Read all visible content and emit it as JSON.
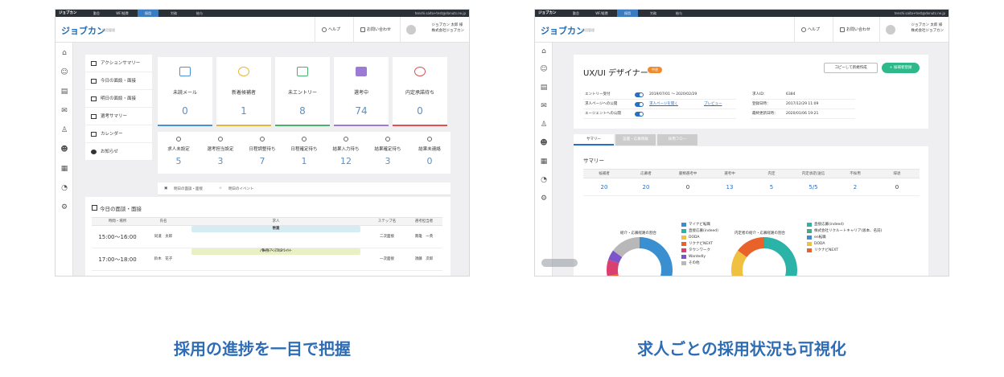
{
  "colors": {
    "accent": "#2e6db5",
    "brand": "#1d6fb8",
    "green": "#2fb88a",
    "orange": "#f08a2d"
  },
  "shotA": {
    "topbar": {
      "logo": "ジョブカン",
      "tabs": [
        "勤怠",
        "WF/経費",
        "採用",
        "労務",
        "給与"
      ],
      "active_tab": "採用",
      "email": "tenshi.saito+test@donuts.ne.jp"
    },
    "header": {
      "logo": "ジョブカン",
      "logo_sub": "採用管理",
      "help": "ヘルプ",
      "contact": "お問い合わせ",
      "user_name": "ジョブカン 太郎 様",
      "company": "株式会社ジョブカン"
    },
    "nav_icons": [
      "home-icon",
      "users-icon",
      "document-icon",
      "mail-icon",
      "person-icon",
      "group-icon",
      "calendar-icon",
      "chart-icon",
      "gear-icon"
    ],
    "submenu": [
      "アクションサマリー",
      "今日の面談・面接",
      "明日の面談・面接",
      "選考サマリー",
      "カレンダー",
      "お知らせ"
    ],
    "cards": [
      {
        "label": "未読メール",
        "value": "0",
        "color": "#4a90d9"
      },
      {
        "label": "新着候補者",
        "value": "1",
        "color": "#e0b83a"
      },
      {
        "label": "未エントリー",
        "value": "8",
        "color": "#4caf70"
      },
      {
        "label": "選考中",
        "value": "74",
        "color": "#9b7bd4"
      },
      {
        "label": "内定承諾待ち",
        "value": "0",
        "color": "#e05050"
      }
    ],
    "stats": [
      {
        "label": "求人未設定",
        "value": "5"
      },
      {
        "label": "選考担当設定",
        "value": "3"
      },
      {
        "label": "日程調整待ち",
        "value": "7"
      },
      {
        "label": "日程確定待ち",
        "value": "1"
      },
      {
        "label": "結果入力待ち",
        "value": "12"
      },
      {
        "label": "結果確定待ち",
        "value": "3"
      },
      {
        "label": "結果未連絡",
        "value": "0"
      }
    ],
    "event_tabs": [
      "明日の面談・面接",
      "明日のイベント"
    ],
    "schedule": {
      "title": "今日の面談・面接",
      "headers": [
        "時間・場所",
        "氏名",
        "求人",
        "ステップ名",
        "選考担当者"
      ],
      "rows": [
        {
          "time": "15:00〜16:00",
          "name": "同道　太郎",
          "job": "中途",
          "job_sub": "営業",
          "step": "二次面接",
          "owner": "南雄　一英",
          "color": "#d6ecf3"
        },
        {
          "time": "17:00〜18:00",
          "name": "鈴木　花子",
          "job": "パート・アルバイト",
          "job_sub": "事務アシスタント",
          "step": "一次面接",
          "owner": "須藤　次郎",
          "color": "#e9f0c4"
        }
      ]
    }
  },
  "shotB": {
    "topbar": {
      "logo": "ジョブカン",
      "tabs": [
        "勤怠",
        "WF/経費",
        "採用",
        "労務",
        "給与"
      ],
      "active_tab": "採用",
      "email": "tenshi.saito+test@donuts.ne.jp"
    },
    "header": {
      "logo": "ジョブカン",
      "logo_sub": "採用管理",
      "help": "ヘルプ",
      "contact": "お問い合わせ",
      "user_name": "ジョブカン 太郎 様",
      "company": "株式会社ジョブカン"
    },
    "job": {
      "title": "UX/UI デザイナー",
      "badge": "中途",
      "copy_button": "コピーして新規作成",
      "register_button": "+ 候補者登録",
      "rows_left": [
        {
          "label": "エントリー受付",
          "value": "2019/07/01 〜 2020/02/29"
        },
        {
          "label": "求人ページへの公開",
          "value": "求人ページを開く",
          "link2": "プレビュー"
        },
        {
          "label": "エージェントへの公開",
          "value": ""
        }
      ],
      "rows_right": [
        {
          "label": "求人ID：",
          "value": "6384"
        },
        {
          "label": "登録日時：",
          "value": "2017/12/29 11:09"
        },
        {
          "label": "最終更新日時：",
          "value": "2020/01/06 19:21"
        }
      ]
    },
    "tabs": [
      "サマリー",
      "設置・応募情報",
      "採用フロー"
    ],
    "summary": {
      "title": "サマリー",
      "headers": [
        "候補者",
        "応募者",
        "書類選考中",
        "選考中",
        "内定",
        "内定承諾/送信",
        "不採用",
        "辞退"
      ],
      "values": [
        "20",
        "20",
        "0",
        "13",
        "5",
        "5/5",
        "2",
        "0"
      ]
    },
    "charts": [
      {
        "title": "紹介・応募経路の割合",
        "type": "donut",
        "slices": [
          {
            "label": "マイナビ転職",
            "value": 30,
            "color": "#3a8fd0"
          },
          {
            "label": "直接応募(indeed)",
            "value": 20,
            "color": "#2bb3a8"
          },
          {
            "label": "DODA",
            "value": 12,
            "color": "#f0c040"
          },
          {
            "label": "リクナビNEXT",
            "value": 10,
            "color": "#e8622a"
          },
          {
            "label": "タウンワーク",
            "value": 8,
            "color": "#d94070"
          },
          {
            "label": "Wantedly",
            "value": 5,
            "color": "#7b55c9"
          },
          {
            "label": "その他",
            "value": 15,
            "color": "#b8b8b8"
          }
        ]
      },
      {
        "title": "内定者の紹介・応募経路の割合",
        "type": "donut",
        "slices": [
          {
            "label": "直接応募(indeed)",
            "value": 30,
            "color": "#2bb3a8"
          },
          {
            "label": "株式会社リクルートキャリア(坂本、名前)",
            "value": 25,
            "color": "#45a88a"
          },
          {
            "label": "en転職",
            "value": 15,
            "color": "#3a8fd0"
          },
          {
            "label": "DODA",
            "value": 15,
            "color": "#f0c040"
          },
          {
            "label": "リクナビNEXT",
            "value": 15,
            "color": "#e8622a"
          }
        ]
      }
    ]
  },
  "captions": {
    "left": "採用の進捗を一目で把握",
    "right": "求人ごとの採用状況も可視化"
  }
}
